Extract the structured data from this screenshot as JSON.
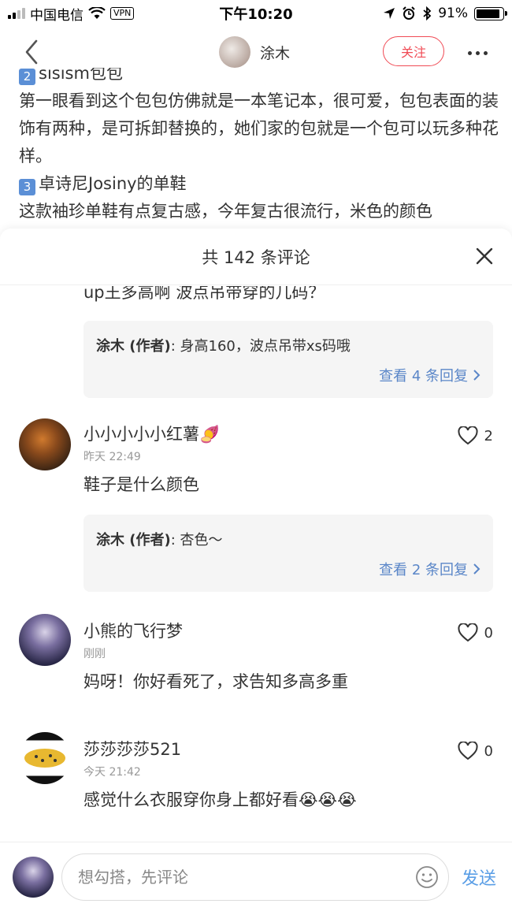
{
  "status_bar": {
    "carrier": "中国电信",
    "vpn": "VPN",
    "time": "下午10:20",
    "battery": "91%",
    "battery_level": 0.91
  },
  "nav": {
    "author_name": "涂木",
    "follow_label": "关注"
  },
  "article": {
    "line0": "sisism包包",
    "para1": "第一眼看到这个包包仿佛就是一本笔记本，很可爱，包包表面的装饰有两种，是可拆卸替换的，她们家的包就是一个包可以玩多种花样。",
    "item3_num": "3",
    "item3_title": "卓诗尼Josiny的单鞋",
    "para2": "这款袖珍单鞋有点复古感，今年复古很流行，米色的颜色"
  },
  "comments_sheet": {
    "title": "共 142 条评论",
    "partial_text": "up王多高啊 波点吊带穿的几码？",
    "partial_reply": {
      "author": "涂木 (作者)",
      "text": ": 身高160，波点吊带xs码哦",
      "more": "查看 4 条回复"
    },
    "items": [
      {
        "name": "小小小小小红薯🍠",
        "time": "昨天 22:49",
        "likes": "2",
        "text": "鞋子是什么颜色",
        "reply": {
          "author": "涂木 (作者)",
          "text": ": 杏色～",
          "more": "查看 2 条回复"
        }
      },
      {
        "name": "小熊的飞行梦",
        "time": "刚刚",
        "likes": "0",
        "text": "妈呀！你好看死了，求告知多高多重"
      },
      {
        "name": "莎莎莎莎521",
        "time": "今天 21:42",
        "likes": "0",
        "text": "感觉什么衣服穿你身上都好看😭😭😭"
      }
    ]
  },
  "bottom_bar": {
    "input_placeholder": "想勾搭，先评论",
    "send_label": "发送"
  }
}
